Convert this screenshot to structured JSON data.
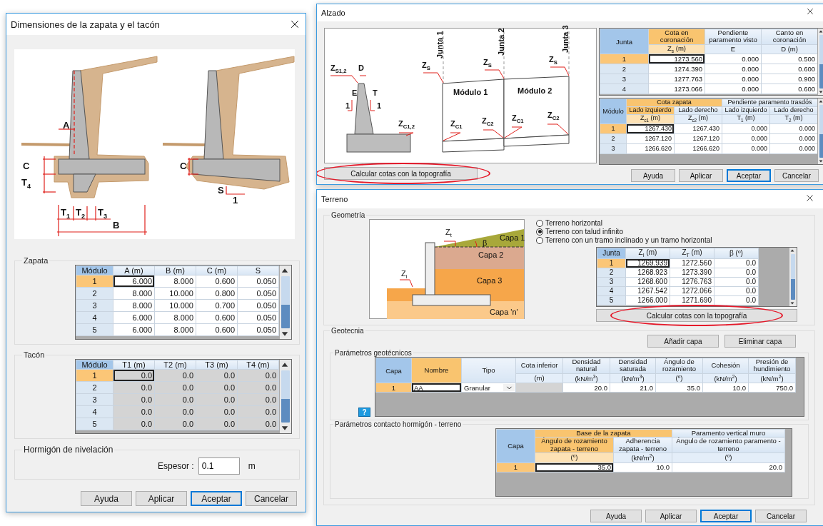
{
  "footing_dialog": {
    "title": "Dimensiones de la zapata y el tacón",
    "drawing_labels": [
      "A",
      "C",
      "T$_{4}$",
      "T$_{1}$",
      "T$_{2}$",
      "T$_{3}$",
      "B",
      "C",
      "S",
      "1"
    ],
    "zapata": {
      "title": "Zapata",
      "corner": "Módulo",
      "disabled": false,
      "columns": [
        {
          "label": "A (m)",
          "kind": "number",
          "selected": false
        },
        {
          "label": "B (m)",
          "kind": "number",
          "selected": false
        },
        {
          "label": "C (m)",
          "kind": "number",
          "selected": false
        },
        {
          "label": "S",
          "kind": "number",
          "selected": false
        }
      ],
      "rows": [
        {
          "head": "1",
          "selected": true,
          "cells": [
            "6.000",
            "8.000",
            "0.600",
            "0.050"
          ]
        },
        {
          "head": "2",
          "selected": false,
          "cells": [
            "8.000",
            "10.000",
            "0.800",
            "0.050"
          ]
        },
        {
          "head": "3",
          "selected": false,
          "cells": [
            "8.000",
            "10.000",
            "0.700",
            "0.050"
          ]
        },
        {
          "head": "4",
          "selected": false,
          "cells": [
            "6.000",
            "8.000",
            "0.600",
            "0.050"
          ]
        },
        {
          "head": "5",
          "selected": false,
          "cells": [
            "6.000",
            "8.000",
            "0.600",
            "0.050"
          ]
        }
      ]
    },
    "tacon": {
      "title": "Tacón",
      "corner": "Módulo",
      "disabled": true,
      "columns": [
        {
          "label": "T1 (m)",
          "kind": "number",
          "selected": false
        },
        {
          "label": "T2 (m)",
          "kind": "number",
          "selected": false
        },
        {
          "label": "T3 (m)",
          "kind": "number",
          "selected": false
        },
        {
          "label": "T4 (m)",
          "kind": "number",
          "selected": false
        }
      ],
      "rows": [
        {
          "head": "1",
          "selected": true,
          "cells": [
            "0.0",
            "0.0",
            "0.0",
            "0.0"
          ]
        },
        {
          "head": "2",
          "selected": false,
          "cells": [
            "0.0",
            "0.0",
            "0.0",
            "0.0"
          ]
        },
        {
          "head": "3",
          "selected": false,
          "cells": [
            "0.0",
            "0.0",
            "0.0",
            "0.0"
          ]
        },
        {
          "head": "4",
          "selected": false,
          "cells": [
            "0.0",
            "0.0",
            "0.0",
            "0.0"
          ]
        },
        {
          "head": "5",
          "selected": false,
          "cells": [
            "0.0",
            "0.0",
            "0.0",
            "0.0"
          ]
        }
      ]
    },
    "leveling": {
      "title": "Hormigón de nivelación",
      "label": "Espesor :",
      "value": "0.1",
      "unit": "m"
    },
    "buttons": [
      {
        "label": "Ayuda",
        "default": false
      },
      {
        "label": "Aplicar",
        "default": false
      },
      {
        "label": "Aceptar",
        "default": true
      },
      {
        "label": "Cancelar",
        "default": false
      }
    ]
  },
  "alzado_dialog": {
    "title": "Alzado",
    "drawing_labels": [
      "Z$_{S1,2}$",
      "D",
      "E",
      "T",
      "1",
      "1",
      "Z$_{C1,2}$",
      "Junta 1",
      "Junta 2",
      "Junta 3",
      "Z$_{S}$",
      "Z$_{S}$",
      "Z$_{S}$",
      "Módulo 1",
      "Módulo 2",
      "Z$_{C1}$",
      "Z$_{C2}$",
      "Z$_{C1}$",
      "Z$_{C2}$"
    ],
    "topo_button": {
      "label": "Calcular cotas con la topografía",
      "highlighted": true
    },
    "joints_table": {
      "corner": "Junta",
      "columns": [
        {
          "label": "Cota en coronación",
          "unit": "Z$_{s}$ (m)",
          "kind": "number",
          "selected": true
        },
        {
          "label": "Pendiente paramento visto",
          "unit": "E",
          "kind": "number",
          "selected": false
        },
        {
          "label": "Canto en coronación",
          "unit": "D (m)",
          "kind": "number",
          "selected": false
        }
      ],
      "rows": [
        {
          "head": "1",
          "selected": true,
          "cells": [
            "1273.560",
            "0.000",
            "0.500"
          ]
        },
        {
          "head": "2",
          "selected": false,
          "cells": [
            "1274.390",
            "0.000",
            "0.600"
          ]
        },
        {
          "head": "3",
          "selected": false,
          "cells": [
            "1277.763",
            "0.000",
            "0.900"
          ]
        },
        {
          "head": "4",
          "selected": false,
          "cells": [
            "1273.066",
            "0.000",
            "0.600"
          ]
        }
      ]
    },
    "modules_table": {
      "corner": "Módulo",
      "groups": [
        {
          "label": "Cota zapata",
          "selected": true
        },
        {
          "label": "Pendiente paramento trasdós",
          "selected": false
        }
      ],
      "columns": [
        {
          "label": "Lado izquierdo",
          "unit": "Z$_{c1}$ (m)",
          "kind": "number",
          "selected": true
        },
        {
          "label": "Lado derecho",
          "unit": "Z$_{c2}$ (m)",
          "kind": "number",
          "selected": false
        },
        {
          "label": "Lado izquierdo",
          "unit": "T$_{1}$ (m)",
          "kind": "number",
          "selected": false
        },
        {
          "label": "Lado derecho",
          "unit": "T$_{2}$ (m)",
          "kind": "number",
          "selected": false
        }
      ],
      "rows": [
        {
          "head": "1",
          "selected": true,
          "cells": [
            "1267.430",
            "1267.430",
            "0.000",
            "0.000"
          ]
        },
        {
          "head": "2",
          "selected": false,
          "cells": [
            "1267.120",
            "1267.120",
            "0.000",
            "0.000"
          ]
        },
        {
          "head": "3",
          "selected": false,
          "cells": [
            "1266.620",
            "1266.620",
            "0.000",
            "0.000"
          ]
        }
      ]
    },
    "buttons": [
      {
        "label": "Ayuda",
        "default": false
      },
      {
        "label": "Aplicar",
        "default": false
      },
      {
        "label": "Aceptar",
        "default": true
      },
      {
        "label": "Cancelar",
        "default": false
      }
    ]
  },
  "terreno_dialog": {
    "title": "Terreno",
    "geometry": {
      "title": "Geometría",
      "drawing_labels": [
        "Z$_{t}$",
        "β",
        "Capa 1",
        "Capa 2",
        "Capa 3",
        "Z$_{i}$",
        "Capa 'n'"
      ],
      "options": [
        {
          "label": "Terreno horizontal",
          "selected": false
        },
        {
          "label": "Terreno con talud infinito",
          "selected": true
        },
        {
          "label": "Terreno con un tramo inclinado y un tramo horizontal",
          "selected": false
        }
      ],
      "table": {
        "corner": "Junta",
        "columns": [
          {
            "label": "Z$_{I}$ (m)",
            "kind": "number",
            "selected": false
          },
          {
            "label": "Z$_{T}$ (m)",
            "kind": "number",
            "selected": false
          },
          {
            "label": "β (º)",
            "kind": "number",
            "selected": false
          }
        ],
        "rows": [
          {
            "head": "1",
            "selected": true,
            "cells": [
              "1269.939",
              "1272.560",
              "0.0"
            ]
          },
          {
            "head": "2",
            "selected": false,
            "cells": [
              "1268.923",
              "1273.390",
              "0.0"
            ]
          },
          {
            "head": "3",
            "selected": false,
            "cells": [
              "1268.600",
              "1276.763",
              "0.0"
            ]
          },
          {
            "head": "4",
            "selected": false,
            "cells": [
              "1267.542",
              "1272.066",
              "0.0"
            ]
          },
          {
            "head": "5",
            "selected": false,
            "cells": [
              "1266.000",
              "1271.690",
              "0.0"
            ]
          }
        ]
      },
      "topo_button": {
        "label": "Calcular cotas con la topografía",
        "highlighted": true
      }
    },
    "geotechnics": {
      "title": "Geotecnia",
      "add_button": "Añadir capa",
      "remove_button": "Eliminar capa",
      "parameters": {
        "title": "Parámetros geotécnicos",
        "help_button": "?",
        "table": {
          "corner": "Capa",
          "columns": [
            {
              "label": "Nombre",
              "kind": "text",
              "selected": true
            },
            {
              "label": "Tipo",
              "kind": "select",
              "selected": false
            },
            {
              "label": "Cota inferior",
              "unit": "(m)",
              "kind": "disabled",
              "selected": false
            },
            {
              "label": "Densidad natural",
              "unit": "(kN/m$^{3}$)",
              "kind": "number",
              "selected": false
            },
            {
              "label": "Densidad saturada",
              "unit": "(kN/m$^{3}$)",
              "kind": "number",
              "selected": false
            },
            {
              "label": "Ángulo de rozamiento",
              "unit": "(º)",
              "kind": "number",
              "selected": false
            },
            {
              "label": "Cohesión",
              "unit": "(kN/m$^{2}$)",
              "kind": "number",
              "selected": false
            },
            {
              "label": "Presión de hundimiento",
              "unit": "(kN/m$^{2}$)",
              "kind": "number",
              "selected": false
            }
          ],
          "rows": [
            {
              "head": "1",
              "selected": true,
              "cells": [
                "AA",
                "Granular",
                null,
                "20.0",
                "21.0",
                "35.0",
                "10.0",
                "750.0"
              ]
            }
          ]
        }
      },
      "contact": {
        "title": "Parámetros contacto hormigón - terreno",
        "table": {
          "corner": "Capa",
          "groups": [
            {
              "label": "Base de la zapata",
              "selected": true
            },
            {
              "label": "Paramento vertical muro",
              "selected": false
            }
          ],
          "columns": [
            {
              "label": "Ángulo de rozamiento zapata - terreno",
              "unit": "(º)",
              "kind": "number",
              "selected": true
            },
            {
              "label": "Adherencia zapata - terreno",
              "unit": "(kN/m$^{2}$)",
              "kind": "number",
              "selected": false
            },
            {
              "label": "Ángulo de rozamiento paramento - terreno",
              "unit": "(º)",
              "kind": "number",
              "selected": false
            }
          ],
          "rows": [
            {
              "head": "1",
              "selected": true,
              "cells": [
                "35.0",
                "10.0",
                "20.0"
              ]
            }
          ]
        }
      }
    },
    "buttons": [
      {
        "label": "Ayuda",
        "default": false
      },
      {
        "label": "Aplicar",
        "default": false
      },
      {
        "label": "Aceptar",
        "default": true
      },
      {
        "label": "Cancelar",
        "default": false
      }
    ]
  }
}
